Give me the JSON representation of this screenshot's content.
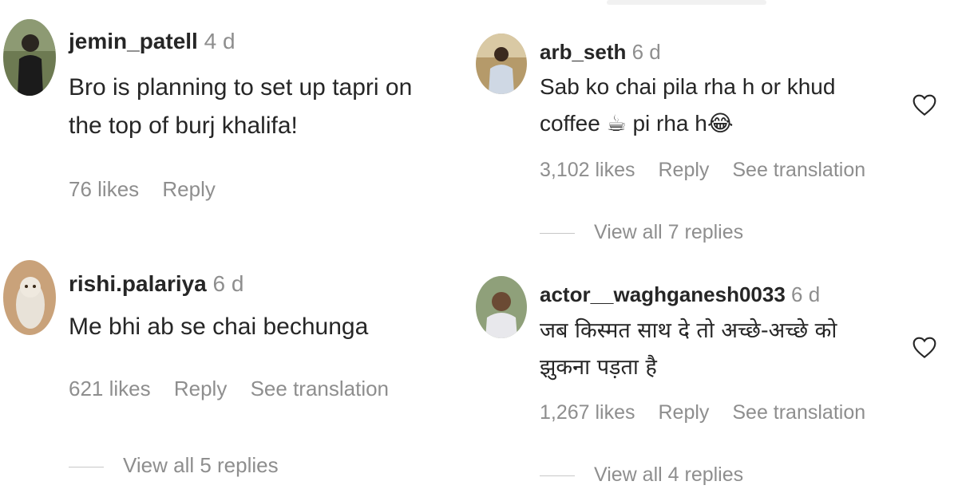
{
  "comments": [
    {
      "username": "jemin_patell",
      "age": "4 d",
      "text_lines": [
        "Bro is planning to set up tapri on",
        "the top of burj khalifa!"
      ],
      "likes": "76 likes",
      "reply": "Reply"
    },
    {
      "username": "rishi.palariya",
      "age": "6 d",
      "text_lines": [
        "Me bhi ab se chai bechunga"
      ],
      "likes": "621 likes",
      "reply": "Reply",
      "translation": "See translation",
      "view_replies": "View all 5 replies"
    },
    {
      "username": "arb_seth",
      "age": "6 d",
      "text_line1": "Sab ko chai pila rha h or khud",
      "text_line2_a": "coffee",
      "text_line2_emoji1": "☕",
      "text_line2_b": "pi rha h",
      "text_line2_emoji2": "😂",
      "likes": "3,102 likes",
      "reply": "Reply",
      "translation": "See translation",
      "view_replies": "View all 7 replies"
    },
    {
      "username": "actor__waghganesh0033",
      "age": "6 d",
      "text_lines": [
        "जब किस्मत साथ दे तो अच्छे-अच्छे को",
        "झुकना पड़ता है"
      ],
      "likes": "1,267 likes",
      "reply": "Reply",
      "translation": "See translation",
      "view_replies": "View all 4 replies"
    }
  ],
  "icons": {
    "like": "heart-outline-icon"
  },
  "colors": {
    "primary_text": "#262626",
    "secondary_text": "#8e8e8e"
  }
}
